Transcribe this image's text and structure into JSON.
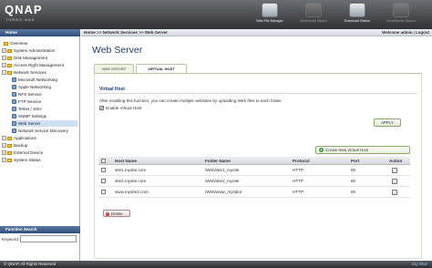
{
  "brand": {
    "logo": "QNAP",
    "tagline": "TURBO NAS"
  },
  "topbar": {
    "apps": [
      {
        "label": "Web File Manager",
        "icon": "web-file-manager-icon"
      },
      {
        "label": "Multimedia Station",
        "icon": "multimedia-station-icon"
      },
      {
        "label": "Download Station",
        "icon": "download-station-icon"
      },
      {
        "label": "Surveillance Station",
        "icon": "surveillance-station-icon"
      }
    ]
  },
  "sidebar": {
    "root": "Home",
    "items": [
      {
        "label": "Overview"
      },
      {
        "label": "System Administration"
      },
      {
        "label": "Disk Management"
      },
      {
        "label": "Access Right Management"
      },
      {
        "label": "Network Services"
      },
      {
        "label": "Microsoft Networking"
      },
      {
        "label": "Apple Networking"
      },
      {
        "label": "NFS Service"
      },
      {
        "label": "FTP Service"
      },
      {
        "label": "Telnet / SSH"
      },
      {
        "label": "SNMP Settings"
      },
      {
        "label": "Web Server"
      },
      {
        "label": "Network Service Discovery"
      },
      {
        "label": "Applications"
      },
      {
        "label": "Backup"
      },
      {
        "label": "External Device"
      },
      {
        "label": "System Status"
      }
    ],
    "function_search": "Function Search",
    "keyword_label": "Keyword :",
    "keyword_value": ""
  },
  "header": {
    "breadcrumb": "Home >> Network Services >> Web Server",
    "welcome_prefix": "Welcome admin",
    "logout": "Logout"
  },
  "page": {
    "title": "Web Server",
    "tabs": [
      "WEB SERVER",
      "VIRTUAL HOST"
    ],
    "section_title": "Virtual Host",
    "description": "After enabling this function, you can create multiple websites by uploading Web files to each folder.",
    "enable_label": "Enable Virtual Host",
    "enable_checked": "✔",
    "apply": "APPLY",
    "create": "Create New Virtual Host"
  },
  "table": {
    "headers": [
      "Host Name",
      "Folder Name",
      "Protocol",
      "Port",
      "Action"
    ],
    "rows": [
      {
        "host": "site1.mysite.com",
        "folder": "/Web/site1_mysite",
        "protocol": "HTTP",
        "port": "80"
      },
      {
        "host": "site2.mysite.com",
        "folder": "/Web/site2_mysite",
        "protocol": "HTTP",
        "port": "80"
      },
      {
        "host": "www.mysite2.com",
        "folder": "/Web/www_mysite2",
        "protocol": "HTTP",
        "port": "80"
      }
    ]
  },
  "delete": "Delete",
  "footer": {
    "copyright": "© QNAP, All Rights Reserved",
    "theme": "Sky Blue"
  }
}
